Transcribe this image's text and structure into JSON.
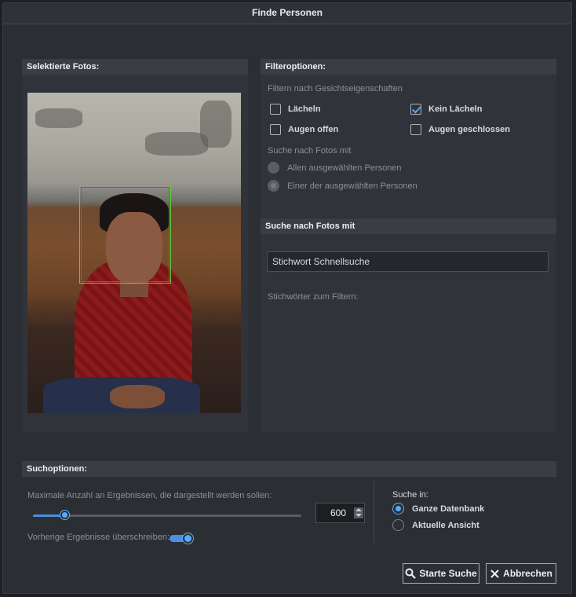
{
  "dialog": {
    "title": "Finde Personen"
  },
  "selected": {
    "header": "Selektierte Fotos:"
  },
  "filter": {
    "header": "Filteroptionen:",
    "subtitle": "Filtern nach Gesichtseigenschaften",
    "options": {
      "smile": {
        "label": "Lächeln",
        "checked": false
      },
      "no_smile": {
        "label": "Kein Lächeln",
        "checked": true
      },
      "eyes_open": {
        "label": "Augen offen",
        "checked": false
      },
      "eyes_closed": {
        "label": "Augen geschlossen",
        "checked": false
      }
    },
    "photos_with_label": "Suche nach Fotos mit",
    "radio_all": "Allen ausgewählten Personen",
    "radio_any": "Einer der ausgewählten Personen"
  },
  "search_photos": {
    "header": "Suche nach Fotos mit",
    "keyword_value": "Stichwort Schnellsuche",
    "keywords_label": "Stichwörter zum Filtern:"
  },
  "search_options": {
    "header": "Suchoptionen:",
    "max_results_label": "Maximale Anzahl an Ergebnissen, die dargestellt werden sollen:",
    "max_results_value": "600",
    "slider_level": 0.12,
    "overwrite_label": "Vorherige Ergebnisse überschreiben:",
    "overwrite_on": true,
    "search_in_label": "Suche in:",
    "whole_db": "Ganze Datenbank",
    "current_view": "Aktuelle Ansicht",
    "selected_scope": "Ganze Datenbank"
  },
  "buttons": {
    "start": "Starte Suche",
    "cancel": "Abbrechen"
  },
  "colors": {
    "accent": "#5aa9ff",
    "face_box": "#5fcf3c"
  }
}
